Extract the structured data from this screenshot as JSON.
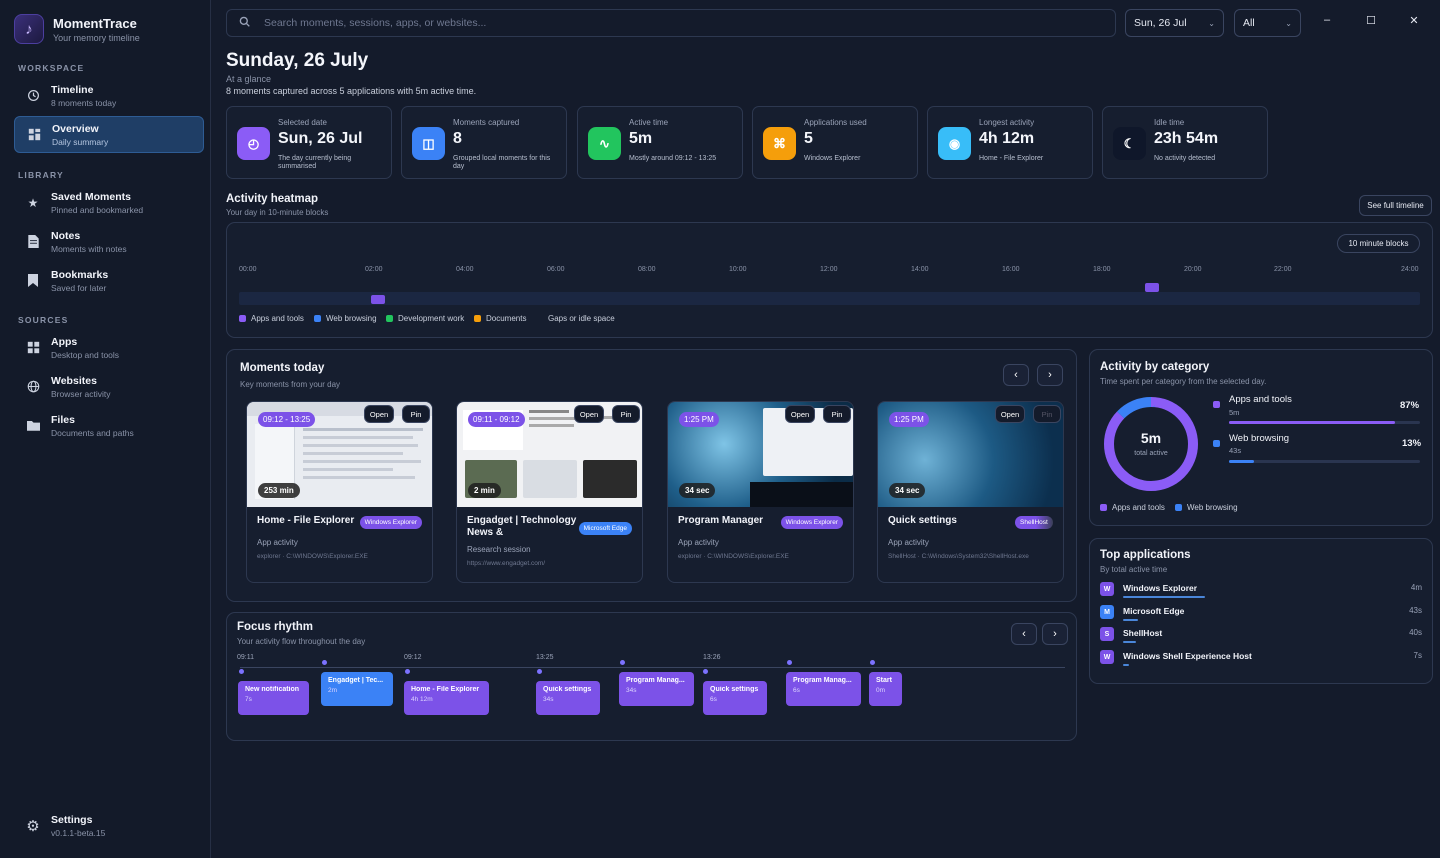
{
  "app": {
    "name": "MomentTrace",
    "tagline": "Your memory timeline",
    "logo_icon": "brand-logo-icon"
  },
  "sidebar": {
    "workspace_label": "WORKSPACE",
    "library_label": "LIBRARY",
    "sources_label": "SOURCES",
    "items": [
      {
        "label": "Timeline",
        "sub": "8 moments today",
        "icon": "history-icon"
      },
      {
        "label": "Overview",
        "sub": "Daily summary",
        "icon": "dashboard-icon"
      },
      {
        "label": "Saved Moments",
        "sub": "Pinned and bookmarked",
        "icon": "star-icon"
      },
      {
        "label": "Notes",
        "sub": "Moments with notes",
        "icon": "document-icon"
      },
      {
        "label": "Bookmarks",
        "sub": "Saved for later",
        "icon": "bookmark-icon"
      },
      {
        "label": "Apps",
        "sub": "Desktop and tools",
        "icon": "grid-icon"
      },
      {
        "label": "Websites",
        "sub": "Browser activity",
        "icon": "globe-icon"
      },
      {
        "label": "Files",
        "sub": "Documents and paths",
        "icon": "folder-icon"
      }
    ],
    "settings": {
      "label": "Settings",
      "sub": "v0.1.1-beta.15",
      "icon": "gear-icon"
    }
  },
  "topbar": {
    "search_placeholder": "Search moments, sessions, apps, or websites...",
    "date_select": "Sun, 26 Jul",
    "filter_select": "All"
  },
  "header": {
    "title": "Sunday, 26 July",
    "glance": "At a glance",
    "summary": "8 moments captured across 5 applications with 5m active time."
  },
  "stats": [
    {
      "label": "Selected date",
      "value": "Sun, 26 Jul",
      "sub": "The day currently being summarised",
      "color": "#8b5cf6"
    },
    {
      "label": "Moments captured",
      "value": "8",
      "sub": "Grouped local moments for this day",
      "color": "#3b82f6"
    },
    {
      "label": "Active time",
      "value": "5m",
      "sub": "Mostly around 09:12 - 13:25",
      "color": "#22c55e"
    },
    {
      "label": "Applications used",
      "value": "5",
      "sub": "Windows Explorer",
      "color": "#f59e0b"
    },
    {
      "label": "Longest activity",
      "value": "4h 12m",
      "sub": "Home - File Explorer",
      "color": "#38bdf8"
    },
    {
      "label": "Idle time",
      "value": "23h 54m",
      "sub": "No activity detected",
      "color": "#0f172a"
    }
  ],
  "heatmap": {
    "title": "Activity heatmap",
    "sub": "Your day in 10-minute blocks",
    "see_full": "See full timeline",
    "block_toggle": "10 minute blocks",
    "ticks": [
      "00:00",
      "02:00",
      "04:00",
      "06:00",
      "08:00",
      "10:00",
      "12:00",
      "14:00",
      "16:00",
      "18:00",
      "20:00",
      "22:00",
      "24:00"
    ],
    "legend": [
      {
        "label": "Apps and tools",
        "color": "#8b5cf6"
      },
      {
        "label": "Web browsing",
        "color": "#3b82f6"
      },
      {
        "label": "Development work",
        "color": "#22c55e"
      },
      {
        "label": "Documents",
        "color": "#f59e0b"
      },
      {
        "label": "Gaps or idle space",
        "color": ""
      }
    ]
  },
  "moments": {
    "title": "Moments today",
    "sub": "Key moments from your day",
    "open_label": "Open",
    "pin_label": "Pin",
    "cards": [
      {
        "time": "09:12 - 13:25",
        "duration": "253 min",
        "title": "Home - File Explorer",
        "app": "Windows Explorer",
        "sub": "App activity",
        "path": "explorer · C:\\WINDOWS\\Explorer.EXE"
      },
      {
        "time": "09:11 - 09:12",
        "duration": "2 min",
        "title": "Engadget | Technology News &",
        "app": "Microsoft Edge",
        "sub": "Research session",
        "path": "https://www.engadget.com/"
      },
      {
        "time": "1:25 PM",
        "duration": "34 sec",
        "title": "Program Manager",
        "app": "Windows Explorer",
        "sub": "App activity",
        "path": "explorer · C:\\WINDOWS\\Explorer.EXE"
      },
      {
        "time": "1:25 PM",
        "duration": "34 sec",
        "title": "Quick settings",
        "app": "ShellHost",
        "sub": "App activity",
        "path": "ShellHost · C:\\Windows\\System32\\ShellHost.exe"
      }
    ]
  },
  "focus": {
    "title": "Focus rhythm",
    "sub": "Your activity flow throughout the day",
    "times": [
      "09:11",
      "09:12",
      "13:25",
      "13:26"
    ],
    "blocks": [
      {
        "title": "New notification",
        "dur": "7s"
      },
      {
        "title": "Engadget | Tec...",
        "dur": "2m"
      },
      {
        "title": "Home - File Explorer",
        "dur": "4h 12m"
      },
      {
        "title": "Quick settings",
        "dur": "34s"
      },
      {
        "title": "Program Manag...",
        "dur": "34s"
      },
      {
        "title": "Quick settings",
        "dur": "6s"
      },
      {
        "title": "Program Manag...",
        "dur": "6s"
      },
      {
        "title": "Start",
        "dur": "0m"
      }
    ]
  },
  "category": {
    "title": "Activity by category",
    "sub": "Time spent per category from the selected day.",
    "total": "5m",
    "total_label": "total active",
    "items": [
      {
        "name": "Apps and tools",
        "value": "5m",
        "pct": "87%",
        "fraction": 0.87,
        "color": "#8b5cf6"
      },
      {
        "name": "Web browsing",
        "value": "43s",
        "pct": "13%",
        "fraction": 0.13,
        "color": "#3b82f6"
      }
    ]
  },
  "top_apps": {
    "title": "Top applications",
    "sub": "By total active time",
    "items": [
      {
        "initial": "W",
        "name": "Windows Explorer",
        "time": "4m",
        "share": 1.0,
        "color": "#7c52e8"
      },
      {
        "initial": "M",
        "name": "Microsoft Edge",
        "time": "43s",
        "share": 0.18,
        "color": "#3b82f6"
      },
      {
        "initial": "S",
        "name": "ShellHost",
        "time": "40s",
        "share": 0.16,
        "color": "#7c52e8"
      },
      {
        "initial": "W",
        "name": "Windows Shell Experience Host",
        "time": "7s",
        "share": 0.05,
        "color": "#7c52e8"
      }
    ]
  }
}
